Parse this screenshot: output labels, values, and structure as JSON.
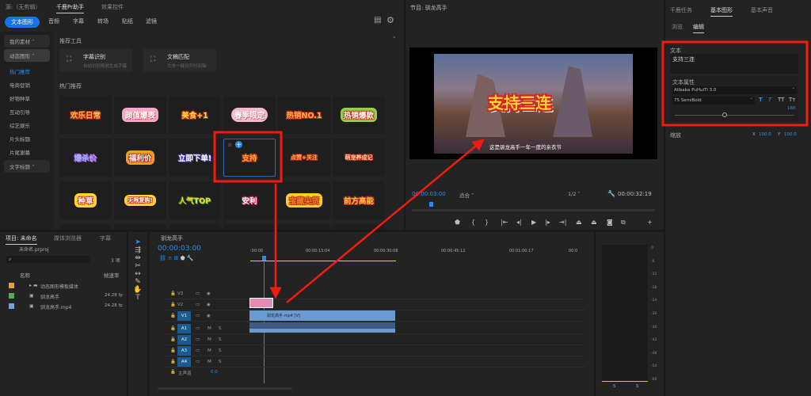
{
  "left_panel": {
    "tabs": [
      "源:（无剪辑）",
      "千鹿Pr助手",
      "效果控件"
    ],
    "categories": [
      "文本图形",
      "音频",
      "字幕",
      "转场",
      "贴纸",
      "滤镜"
    ],
    "sidebar": [
      "我的素材",
      "动态图形",
      "热门推荐",
      "电商促销",
      "好物种草",
      "互动引导",
      "综艺娱乐",
      "片头标题",
      "片尾谢幕",
      "文字标题"
    ],
    "section_tools": "推荐工具",
    "tools": [
      {
        "title": "字幕识别",
        "desc": "自动识别视频生成字幕"
      },
      {
        "title": "文稿匹配",
        "desc": "文本一键对齐时间轴"
      }
    ],
    "section_hot": "热门推荐",
    "stickers": [
      "欢乐日常",
      "颜值爆表",
      "美食+1",
      "春季限定",
      "热销NO.1",
      "热销爆款",
      "爆杀价",
      "福利价",
      "立即下单!",
      "支持",
      "点赞+关注",
      "萌宠养成记",
      "种草",
      "无限复购!",
      "人气TOP",
      "安利",
      "宝藏尖货",
      "前方高能"
    ]
  },
  "program": {
    "title": "节目: 驯龙高手",
    "overlay_text": "支持三连",
    "subtitle": "这是驯龙高手一年一度的亲衣节",
    "timecode": "00:00:03:00",
    "fit": "适合",
    "quality": "1/2",
    "duration": "00:00:32:19"
  },
  "essential": {
    "tabs": [
      "千鹿任务",
      "基本图形",
      "基本声音"
    ],
    "subtabs": [
      "浏览",
      "编辑"
    ],
    "text_label": "文本",
    "text_value": "支持三连",
    "props_label": "文本属性",
    "font": "Alibaba PuHuiTi 3.0",
    "weight": "75 SemiBold",
    "size": "160",
    "scale_label": "缩放",
    "x_label": "X",
    "x": "100.0",
    "y_label": "Y",
    "y": "100.0",
    "style_buttons": [
      "T",
      "T",
      "TT",
      "Tт"
    ]
  },
  "project": {
    "tabs": [
      "项目: 未命名",
      "媒体浏览器",
      "字幕"
    ],
    "file": "未命名.prproj",
    "count": "3 项",
    "headers": [
      "名称",
      "帧速率"
    ],
    "rows": [
      {
        "name": "动态图形模板媒体",
        "fps": "",
        "color": "#e8a030"
      },
      {
        "name": "驯龙高手",
        "fps": "24.28 fp",
        "color": "#4caf50"
      },
      {
        "name": "驯龙高手.mp4",
        "fps": "24.28 fp",
        "color": "#6fa3dc"
      }
    ]
  },
  "timeline": {
    "title": "驯龙高手",
    "timecode": "00:00:03:00",
    "ruler": [
      ":00:00",
      "00:00:15:04",
      "00:00:30:08",
      "00:00:45:12",
      "00:01:00:17",
      "00:0"
    ],
    "video_tracks": [
      "V3",
      "V2",
      "V1"
    ],
    "audio_tracks": [
      "A1",
      "A2",
      "A3",
      "A4"
    ],
    "master": "主声道",
    "master_val": "0.0",
    "clip_v1": "驯龙高手.mp4 [V]"
  },
  "meter": {
    "ticks": [
      "0",
      "-6",
      "-12",
      "-18",
      "-24",
      "-30",
      "-36",
      "-42",
      "-48",
      "-54",
      "-60"
    ],
    "solo": [
      "S",
      "S"
    ]
  }
}
